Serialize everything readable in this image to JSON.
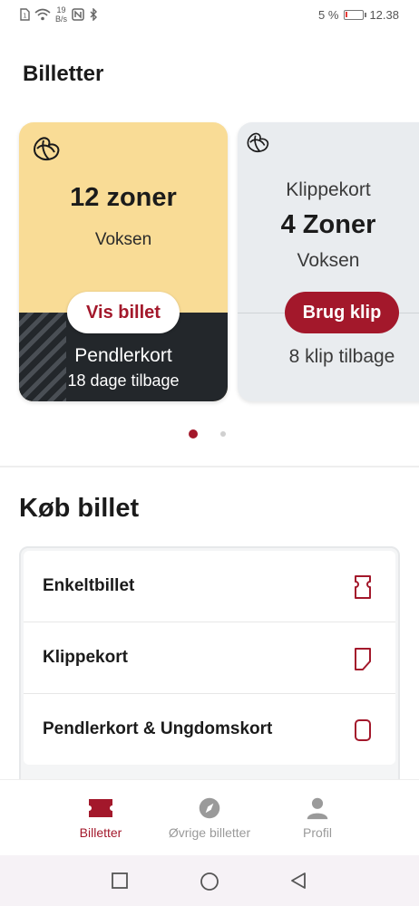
{
  "status_bar": {
    "speed_value": "19",
    "speed_unit": "B/s",
    "battery_percent": "5 %",
    "battery_level": 0.05,
    "time": "12.38"
  },
  "header": {
    "title": "Billetter"
  },
  "cards": [
    {
      "zones": "12 zoner",
      "passenger": "Voksen",
      "button": "Vis billet",
      "ticket_type": "Pendlerkort",
      "remaining": "18 dage tilbage",
      "bg_color": "#f9dc96"
    },
    {
      "title": "Klippekort",
      "zones": "4 Zoner",
      "passenger": "Voksen",
      "button": "Brug klip",
      "remaining": "8 klip tilbage",
      "bg_color": "#e9ecef"
    }
  ],
  "pager": {
    "current": 1,
    "total": 2
  },
  "buy_section": {
    "title": "Køb billet",
    "items": [
      {
        "label": "Enkeltbillet",
        "icon": "single-ticket-icon"
      },
      {
        "label": "Klippekort",
        "icon": "clip-card-icon"
      },
      {
        "label": "Pendlerkort & Ungdomskort",
        "icon": "pass-card-icon"
      }
    ]
  },
  "bottom_nav": [
    {
      "label": "Billetter",
      "icon": "ticket-icon",
      "active": true
    },
    {
      "label": "Øvrige billetter",
      "icon": "compass-icon",
      "active": false
    },
    {
      "label": "Profil",
      "icon": "profile-icon",
      "active": false
    }
  ],
  "colors": {
    "accent": "#a3182b",
    "card_dark": "#23272b",
    "inactive": "#9a9a9a"
  }
}
